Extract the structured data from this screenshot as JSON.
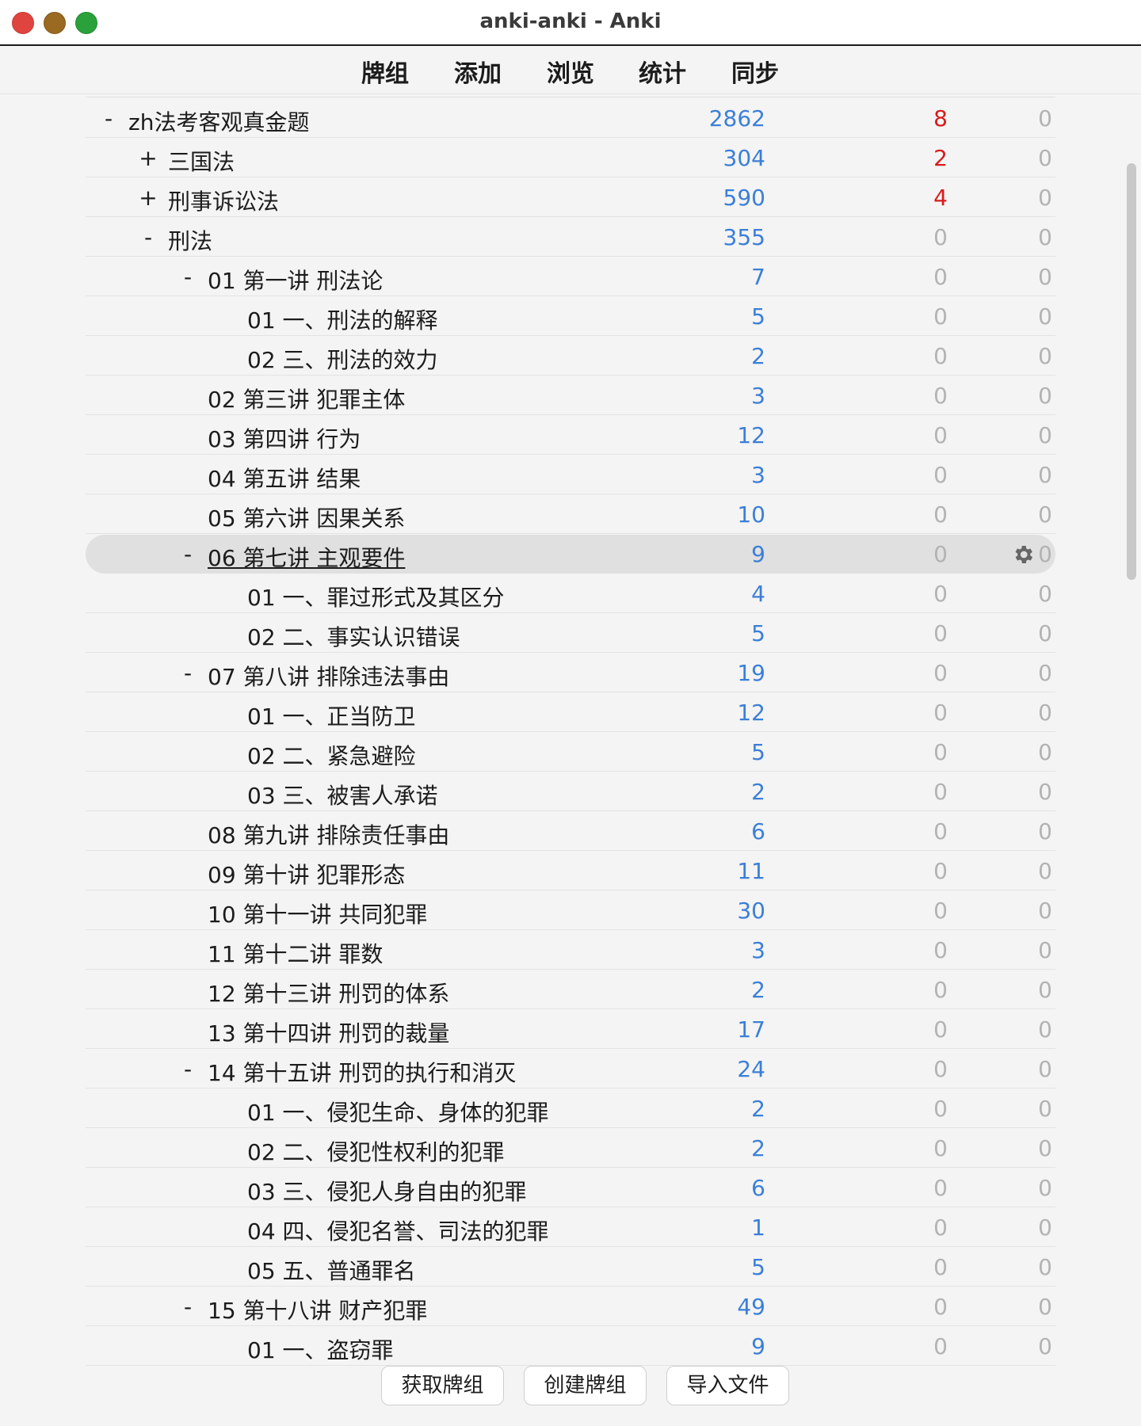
{
  "window": {
    "title": "anki-anki - Anki"
  },
  "nav": {
    "decks": "牌组",
    "add": "添加",
    "browse": "浏览",
    "stats": "统计",
    "sync": "同步"
  },
  "decks": [
    {
      "collapse": "-",
      "name": "zh法考客观真金题",
      "due": "2862",
      "learn": "8",
      "new": "0",
      "level": 0,
      "learn_red": true
    },
    {
      "collapse": "+",
      "name": "三国法",
      "due": "304",
      "learn": "2",
      "new": "0",
      "level": 1,
      "learn_red": true
    },
    {
      "collapse": "+",
      "name": "刑事诉讼法",
      "due": "590",
      "learn": "4",
      "new": "0",
      "level": 1,
      "learn_red": true
    },
    {
      "collapse": "-",
      "name": "刑法",
      "due": "355",
      "learn": "0",
      "new": "0",
      "level": 1
    },
    {
      "collapse": "-",
      "name": "01 第一讲 刑法论",
      "due": "7",
      "learn": "0",
      "new": "0",
      "level": 2
    },
    {
      "collapse": "",
      "name": "01 一、刑法的解释",
      "due": "5",
      "learn": "0",
      "new": "0",
      "level": 3
    },
    {
      "collapse": "",
      "name": "02 三、刑法的效力",
      "due": "2",
      "learn": "0",
      "new": "0",
      "level": 3
    },
    {
      "collapse": "",
      "name": "02 第三讲 犯罪主体",
      "due": "3",
      "learn": "0",
      "new": "0",
      "level": 2
    },
    {
      "collapse": "",
      "name": "03 第四讲 行为",
      "due": "12",
      "learn": "0",
      "new": "0",
      "level": 2
    },
    {
      "collapse": "",
      "name": "04 第五讲 结果",
      "due": "3",
      "learn": "0",
      "new": "0",
      "level": 2
    },
    {
      "collapse": "",
      "name": "05 第六讲 因果关系",
      "due": "10",
      "learn": "0",
      "new": "0",
      "level": 2
    },
    {
      "collapse": "-",
      "name": "06 第七讲 主观要件",
      "due": "9",
      "learn": "0",
      "new": "0",
      "level": 2,
      "current": true
    },
    {
      "collapse": "",
      "name": "01 一、罪过形式及其区分",
      "due": "4",
      "learn": "0",
      "new": "0",
      "level": 3
    },
    {
      "collapse": "",
      "name": "02 二、事实认识错误",
      "due": "5",
      "learn": "0",
      "new": "0",
      "level": 3
    },
    {
      "collapse": "-",
      "name": "07 第八讲 排除违法事由",
      "due": "19",
      "learn": "0",
      "new": "0",
      "level": 2
    },
    {
      "collapse": "",
      "name": "01 一、正当防卫",
      "due": "12",
      "learn": "0",
      "new": "0",
      "level": 3
    },
    {
      "collapse": "",
      "name": "02 二、紧急避险",
      "due": "5",
      "learn": "0",
      "new": "0",
      "level": 3
    },
    {
      "collapse": "",
      "name": "03 三、被害人承诺",
      "due": "2",
      "learn": "0",
      "new": "0",
      "level": 3
    },
    {
      "collapse": "",
      "name": "08 第九讲 排除责任事由",
      "due": "6",
      "learn": "0",
      "new": "0",
      "level": 2
    },
    {
      "collapse": "",
      "name": "09 第十讲 犯罪形态",
      "due": "11",
      "learn": "0",
      "new": "0",
      "level": 2
    },
    {
      "collapse": "",
      "name": "10 第十一讲 共同犯罪",
      "due": "30",
      "learn": "0",
      "new": "0",
      "level": 2
    },
    {
      "collapse": "",
      "name": "11 第十二讲 罪数",
      "due": "3",
      "learn": "0",
      "new": "0",
      "level": 2
    },
    {
      "collapse": "",
      "name": "12 第十三讲 刑罚的体系",
      "due": "2",
      "learn": "0",
      "new": "0",
      "level": 2
    },
    {
      "collapse": "",
      "name": "13 第十四讲 刑罚的裁量",
      "due": "17",
      "learn": "0",
      "new": "0",
      "level": 2
    },
    {
      "collapse": "-",
      "name": "14 第十五讲 刑罚的执行和消灭",
      "due": "24",
      "learn": "0",
      "new": "0",
      "level": 2
    },
    {
      "collapse": "",
      "name": "01 一、侵犯生命、身体的犯罪",
      "due": "2",
      "learn": "0",
      "new": "0",
      "level": 3
    },
    {
      "collapse": "",
      "name": "02 二、侵犯性权利的犯罪",
      "due": "2",
      "learn": "0",
      "new": "0",
      "level": 3
    },
    {
      "collapse": "",
      "name": "03 三、侵犯人身自由的犯罪",
      "due": "6",
      "learn": "0",
      "new": "0",
      "level": 3
    },
    {
      "collapse": "",
      "name": "04 四、侵犯名誉、司法的犯罪",
      "due": "1",
      "learn": "0",
      "new": "0",
      "level": 3
    },
    {
      "collapse": "",
      "name": "05 五、普通罪名",
      "due": "5",
      "learn": "0",
      "new": "0",
      "level": 3
    },
    {
      "collapse": "-",
      "name": "15 第十八讲 财产犯罪",
      "due": "49",
      "learn": "0",
      "new": "0",
      "level": 2
    },
    {
      "collapse": "",
      "name": "01 一、盗窃罪",
      "due": "9",
      "learn": "0",
      "new": "0",
      "level": 3
    }
  ],
  "icons": {
    "deck_options": "gear-icon"
  },
  "colors": {
    "due": "#3b7fd8",
    "learn_active": "#d81b1b",
    "zero": "#b3b3b3"
  },
  "bottom": {
    "get_shared": "获取牌组",
    "create_deck": "创建牌组",
    "import_file": "导入文件"
  }
}
